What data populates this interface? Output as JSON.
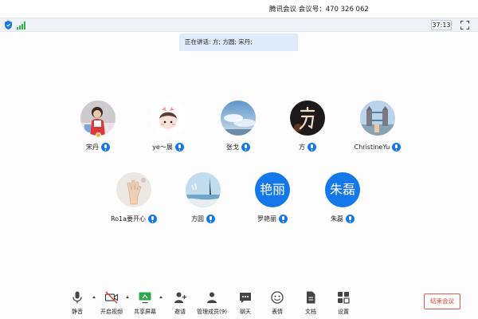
{
  "window": {
    "title": "腾讯会议  会议号：470 326 062"
  },
  "infobar": {
    "timer": "37:13",
    "colors": {
      "shield": "#1677e8",
      "signal": "#2fb24a"
    }
  },
  "speaking": {
    "text": "正在讲话: 方; 方圆; 宋丹;"
  },
  "participants": [
    {
      "name": "宋丹",
      "avatar": "photo-girl-icon"
    },
    {
      "name": "ye～展",
      "avatar": "photo-cartoon-icon"
    },
    {
      "name": "张戈",
      "avatar": "photo-sky-icon"
    },
    {
      "name": "方",
      "avatar": "photo-dark-text-icon"
    },
    {
      "name": "ChristineYu",
      "avatar": "photo-tower-bridge-icon"
    },
    {
      "name": "Ro1a要开心",
      "avatar": "photo-hand-icon"
    },
    {
      "name": "方圆",
      "avatar": "photo-seaside-icon"
    },
    {
      "name": "罗艳丽",
      "avatar_text": "艳丽"
    },
    {
      "name": "朱磊",
      "avatar_text": "朱磊"
    }
  ],
  "toolbar": {
    "mute": "静音",
    "video": "开启视频",
    "share": "共享屏幕",
    "invite": "邀请",
    "members": "管理成员(9)",
    "chat": "聊天",
    "reaction": "表情",
    "docs": "文档",
    "settings": "设置",
    "end": "结束会议"
  },
  "colors": {
    "accent": "#1677e8",
    "end": "#e23b32",
    "speaking_bg": "#dfeafb"
  }
}
